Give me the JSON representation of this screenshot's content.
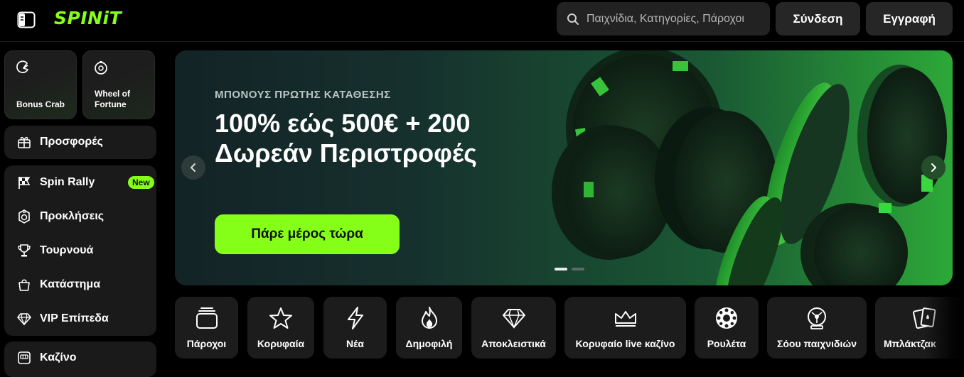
{
  "header": {
    "logo": "SPINiT",
    "search_placeholder": "Παιχνίδια, Κατηγορίες, Πάροχοι",
    "login_label": "Σύνδεση",
    "register_label": "Εγγραφή"
  },
  "sidebar": {
    "promo_cards": [
      {
        "label": "Bonus Crab",
        "icon": "crab-claw-icon"
      },
      {
        "label": "Wheel of Fortune",
        "icon": "wheel-icon"
      }
    ],
    "offers_label": "Προσφορές",
    "items": [
      {
        "label": "Spin Rally",
        "icon": "checkered-flag-icon",
        "badge": "New"
      },
      {
        "label": "Προκλήσεις",
        "icon": "challenge-icon"
      },
      {
        "label": "Τουρνουά",
        "icon": "trophy-icon"
      },
      {
        "label": "Κατάστημα",
        "icon": "shopping-bag-icon"
      },
      {
        "label": "VIP Επίπεδα",
        "icon": "diamond-icon"
      }
    ],
    "casino_label": "Καζίνο"
  },
  "hero": {
    "eyebrow": "ΜΠΟΝΟΥΣ ΠΡΩΤΗΣ ΚΑΤΑΘΕΣΗΣ",
    "headline": "100% εώς 500€ + 200 Δωρεάν Περιστροφές",
    "cta_label": "Πάρε μέρος τώρα",
    "slide_count": 2,
    "active_slide": 1
  },
  "categories": [
    {
      "label": "Πάροχοι",
      "icon": "cards-stack-icon"
    },
    {
      "label": "Κορυφαία",
      "icon": "star-icon"
    },
    {
      "label": "Νέα",
      "icon": "lightning-icon"
    },
    {
      "label": "Δημοφιλή",
      "icon": "flame-icon"
    },
    {
      "label": "Αποκλειστικά",
      "icon": "diamond-icon"
    },
    {
      "label": "Κορυφαίο live καζίνο",
      "icon": "crown-icon"
    },
    {
      "label": "Ρουλέτα",
      "icon": "roulette-icon"
    },
    {
      "label": "Σόου παιχνιδιών",
      "icon": "game-show-icon"
    },
    {
      "label": "Μπλάκτζακ",
      "icon": "playing-cards-icon"
    }
  ],
  "colors": {
    "accent": "#86ff18",
    "background": "#000000",
    "panel": "#1a1a1a"
  }
}
